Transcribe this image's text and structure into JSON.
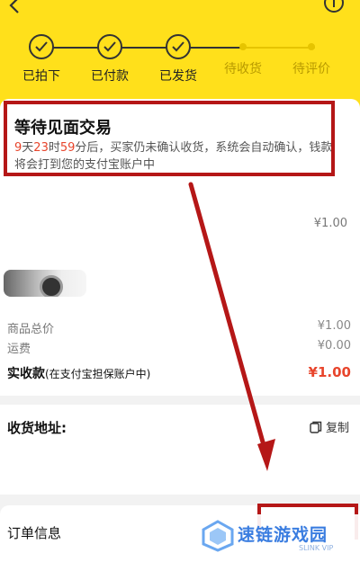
{
  "steps": [
    {
      "label": "已拍下",
      "done": true
    },
    {
      "label": "已付款",
      "done": true
    },
    {
      "label": "已发货",
      "done": true
    },
    {
      "label": "待收货",
      "done": false
    },
    {
      "label": "待评价",
      "done": false
    }
  ],
  "status": {
    "title": "等待见面交易",
    "days": "9",
    "d_unit": "天",
    "hours": "23",
    "h_unit": "时",
    "minutes": "59",
    "m_unit": "分",
    "desc_rest": "后，买家仍未确认收货，系统会自动确认，钱款将会打到您的支付宝账户中"
  },
  "order": {
    "item_price": "¥1.00",
    "goods_total_label": "商品总价",
    "goods_total": "¥1.00",
    "shipping_label": "运费",
    "shipping": "¥0.00",
    "paid_label": "实收款",
    "paid_note": "(在支付宝担保账户中)",
    "paid": "¥1.00"
  },
  "address": {
    "label": "收货地址:",
    "copy_label": "复制"
  },
  "order_info": {
    "label": "订单信息"
  },
  "watermark": {
    "text": "速链游戏园",
    "sub": "SLINK VIP"
  },
  "colors": {
    "header": "#ffe01b",
    "accent_red": "#e8452c",
    "annotation_red": "#b51717",
    "watermark_blue": "#3a7de0"
  }
}
